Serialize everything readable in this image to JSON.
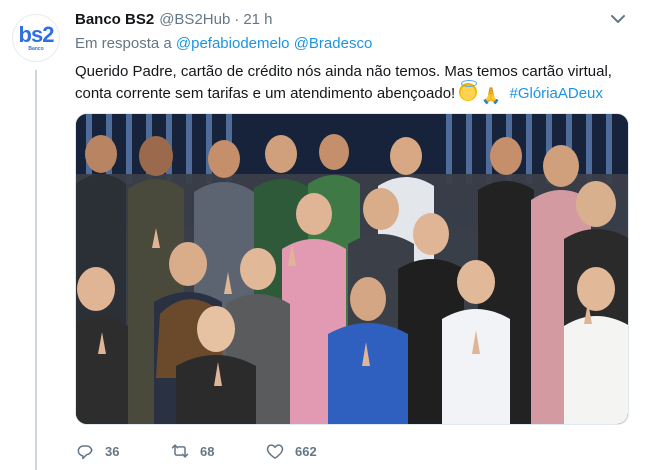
{
  "account": {
    "name": "Banco BS2",
    "handle": "@BS2Hub",
    "separator": "·",
    "time": "21 h",
    "avatar_mark": "bs2",
    "avatar_sub": "Banco"
  },
  "reply_to": {
    "prefix": "Em resposta a",
    "mentions": [
      "@pefabiodemelo",
      "@Bradesco"
    ]
  },
  "tweet": {
    "line1": "Querido Padre, cartão de crédito nós ainda não temos. Mas temos cartão virtual,",
    "line2": "conta corrente sem tarifas e um atendimento abençoado!",
    "hashtag": "#GlóriaADeux",
    "emojis": [
      "smiling-face-with-halo",
      "folded-hands"
    ]
  },
  "actions": {
    "replies": "36",
    "retweets": "68",
    "likes": "662"
  },
  "colors": {
    "link": "#1b95e0",
    "secondary_text": "#657786",
    "brand": "#2f6fe3"
  }
}
